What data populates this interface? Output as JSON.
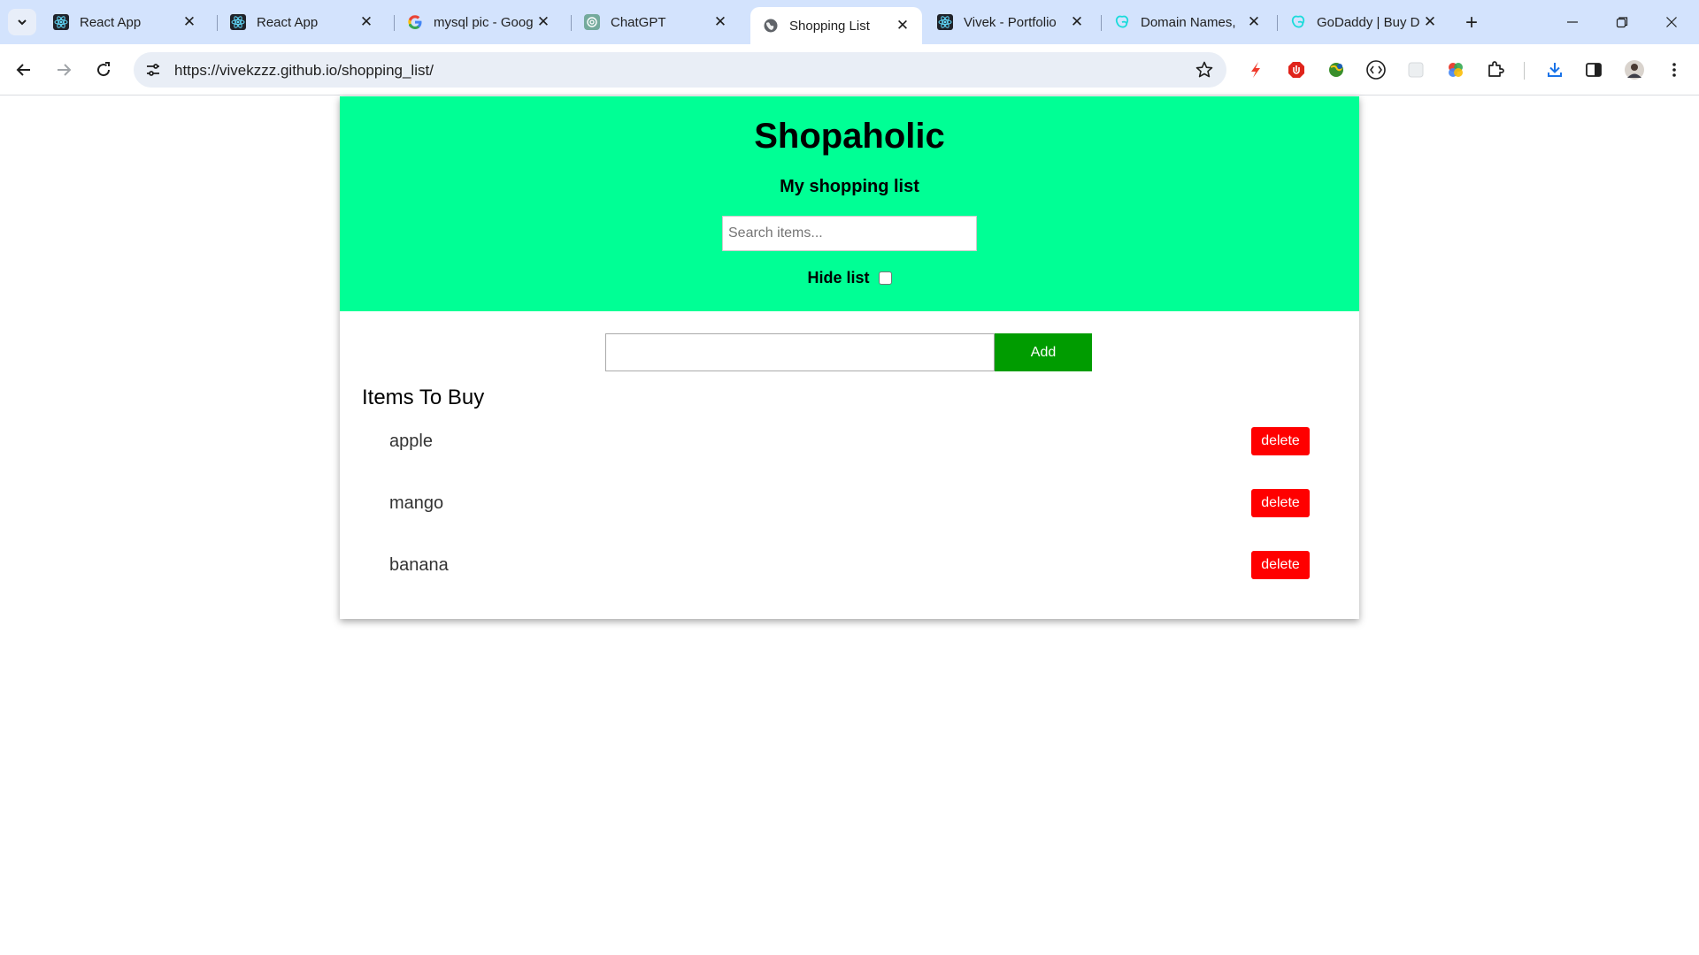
{
  "browser": {
    "tabs": [
      {
        "title": "React App",
        "icon": "react-icon",
        "active": false
      },
      {
        "title": "React App",
        "icon": "react-icon",
        "active": false
      },
      {
        "title": "mysql pic - Goog",
        "icon": "google-icon",
        "active": false
      },
      {
        "title": "ChatGPT",
        "icon": "chatgpt-icon",
        "active": false
      },
      {
        "title": "Shopping List",
        "icon": "globe-icon",
        "active": true
      },
      {
        "title": "Vivek - Portfolio",
        "icon": "react-icon",
        "active": false
      },
      {
        "title": "Domain Names,",
        "icon": "godaddy-icon",
        "active": false
      },
      {
        "title": "GoDaddy | Buy D",
        "icon": "godaddy-icon",
        "active": false
      }
    ],
    "url": "https://vivekzzz.github.io/shopping_list/"
  },
  "app": {
    "title": "Shopaholic",
    "subtitle": "My shopping list",
    "search_placeholder": "Search items...",
    "hide_list_label": "Hide list",
    "hide_list_checked": false,
    "add_input_value": "",
    "add_button_label": "Add",
    "list_heading": "Items To Buy",
    "delete_label": "delete",
    "items": [
      "apple",
      "mango",
      "banana"
    ]
  },
  "colors": {
    "header_bg": "#00ff95",
    "add_button": "#009c00",
    "delete_button": "#ff0000"
  }
}
